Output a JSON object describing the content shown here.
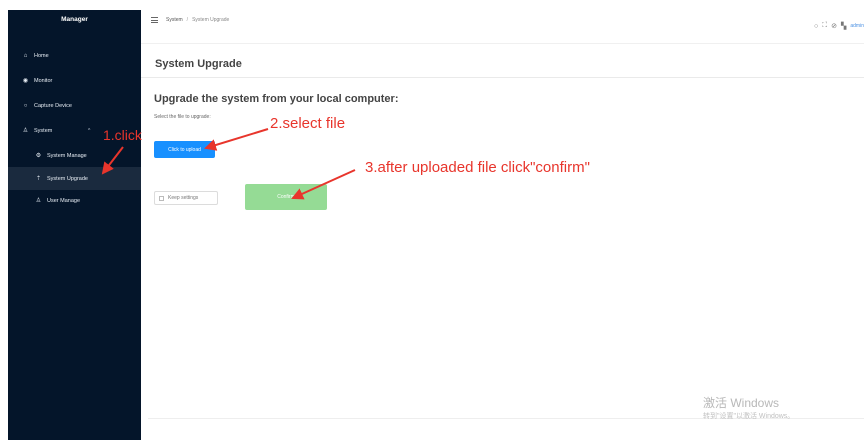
{
  "sidebar": {
    "title": "Manager",
    "items": [
      {
        "label": "Home",
        "icon": "home-icon"
      },
      {
        "label": "Monitor",
        "icon": "monitor-icon"
      },
      {
        "label": "Capture Device",
        "icon": "search-icon"
      },
      {
        "label": "System",
        "icon": "user-icon"
      },
      {
        "label": "System Manage",
        "icon": "gear-icon"
      },
      {
        "label": "System Upgrade",
        "icon": "upload-icon"
      },
      {
        "label": "User Manage",
        "icon": "person-icon"
      }
    ]
  },
  "header": {
    "breadcrumb": [
      "System",
      "System Upgrade"
    ],
    "user": "admin"
  },
  "page": {
    "title": "System Upgrade",
    "heading": "Upgrade the system from your local computer:",
    "select_label": "Select the file to upgrade:",
    "upload_button": "Click to upload",
    "keep_settings": "Keep settings",
    "confirm_button": "Confirm"
  },
  "annotations": {
    "step1": "1.click",
    "step2": "2.select file",
    "step3": "3.after uploaded file click\"confirm\"",
    "color": "#e8352c"
  },
  "watermark": {
    "title": "激活 Windows",
    "subtitle": "转到\"设置\"以激活 Windows。"
  },
  "colors": {
    "sidebar_bg": "#04152a",
    "primary": "#1890ff",
    "confirm_disabled": "#95db95"
  }
}
